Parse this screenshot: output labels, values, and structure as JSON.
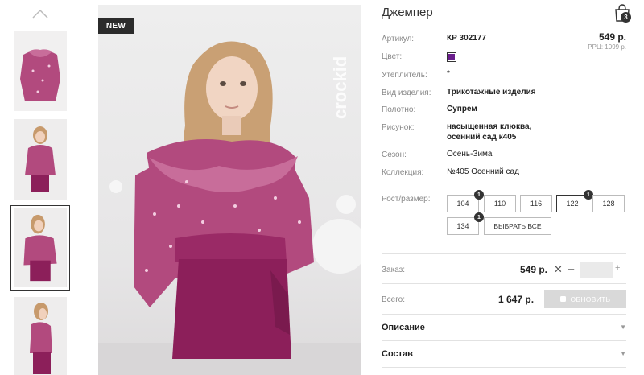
{
  "badge": "NEW",
  "brand_logo_text": "crockid",
  "product": {
    "title": "Джемпер",
    "price": "549 р.",
    "rrp": "РРЦ: 1099 р."
  },
  "cart": {
    "count": "3"
  },
  "details": [
    {
      "label": "Артикул:",
      "value": "КР 302177"
    },
    {
      "label": "Цвет:",
      "value": ""
    },
    {
      "label": "Утеплитель:",
      "value": "*"
    },
    {
      "label": "Вид изделия:",
      "value": "Трикотажные изделия"
    },
    {
      "label": "Полотно:",
      "value": "Супрем"
    },
    {
      "label": "Рисунок:",
      "value_line1": "насыщенная клюква,",
      "value_line2": "осенний сад к405"
    },
    {
      "label": "Сезон:",
      "value": "Осень-Зима"
    },
    {
      "label": "Коллекция:",
      "value": "№405 Осенний сад"
    }
  ],
  "color_swatch": "#6a1e8c",
  "sizes": {
    "label": "Рост/размер:",
    "options": [
      {
        "size": "104",
        "count": "1",
        "selected": false
      },
      {
        "size": "110",
        "count": "",
        "selected": false
      },
      {
        "size": "116",
        "count": "",
        "selected": false
      },
      {
        "size": "122",
        "count": "1",
        "selected": true
      },
      {
        "size": "128",
        "count": "",
        "selected": false
      },
      {
        "size": "134",
        "count": "1",
        "selected": false
      }
    ],
    "select_all": "ВЫБРАТЬ ВСЕ"
  },
  "order": {
    "label": "Заказ:",
    "price": "549 р.",
    "remove": "✕",
    "minus": "–",
    "plus": "+",
    "quantity": ""
  },
  "total": {
    "label": "Всего:",
    "value": "1 647 р.",
    "refresh": "ОБНОВИТЬ"
  },
  "accordion": [
    {
      "title": "Описание"
    },
    {
      "title": "Состав"
    }
  ],
  "colors": {
    "accent_dark": "#333333",
    "muted": "#888888",
    "skirt": "#8c1f5a",
    "shirt": "#b24a7e"
  }
}
